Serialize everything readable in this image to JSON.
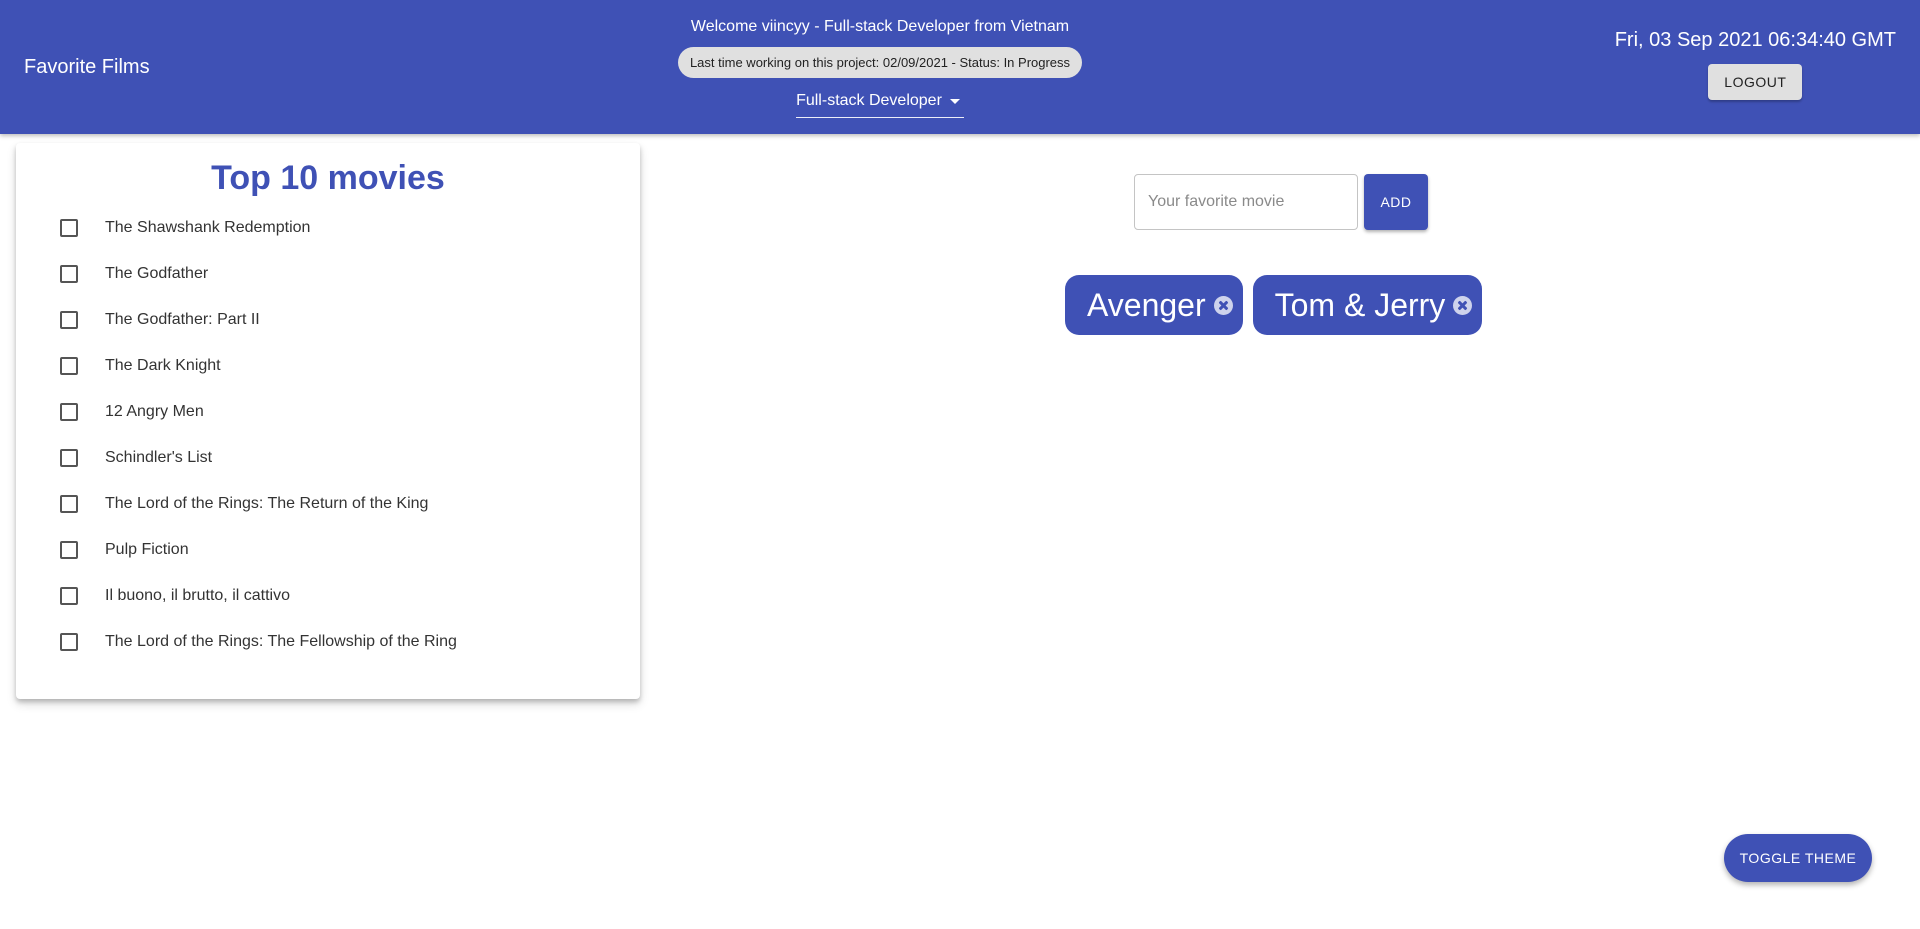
{
  "header": {
    "title": "Favorite Films",
    "welcome": "Welcome viincyy - Full-stack Developer from Vietnam",
    "status": "Last time working on this project: 02/09/2021 - Status: In Progress",
    "role": "Full-stack Developer",
    "datetime": "Fri, 03 Sep 2021 06:34:40 GMT",
    "logout_label": "LOGOUT"
  },
  "top_movies": {
    "title": "Top 10 movies",
    "items": [
      {
        "label": "The Shawshank Redemption",
        "checked": false
      },
      {
        "label": "The Godfather",
        "checked": false
      },
      {
        "label": "The Godfather: Part II",
        "checked": false
      },
      {
        "label": "The Dark Knight",
        "checked": false
      },
      {
        "label": "12 Angry Men",
        "checked": false
      },
      {
        "label": "Schindler's List",
        "checked": false
      },
      {
        "label": "The Lord of the Rings: The Return of the King",
        "checked": false
      },
      {
        "label": "Pulp Fiction",
        "checked": false
      },
      {
        "label": "Il buono, il brutto, il cattivo",
        "checked": false
      },
      {
        "label": "The Lord of the Rings: The Fellowship of the Ring",
        "checked": false
      }
    ]
  },
  "add_form": {
    "placeholder": "Your favorite movie",
    "value": "",
    "add_label": "ADD"
  },
  "favorites": [
    {
      "label": "Avenger",
      "delete_icon": "cancel-icon"
    },
    {
      "label": "Tom & Jerry",
      "delete_icon": "cancel-icon"
    }
  ],
  "toggle_theme_label": "TOGGLE THEME",
  "colors": {
    "primary": "#3f51b5",
    "chip_gray": "#e0e0e0"
  }
}
